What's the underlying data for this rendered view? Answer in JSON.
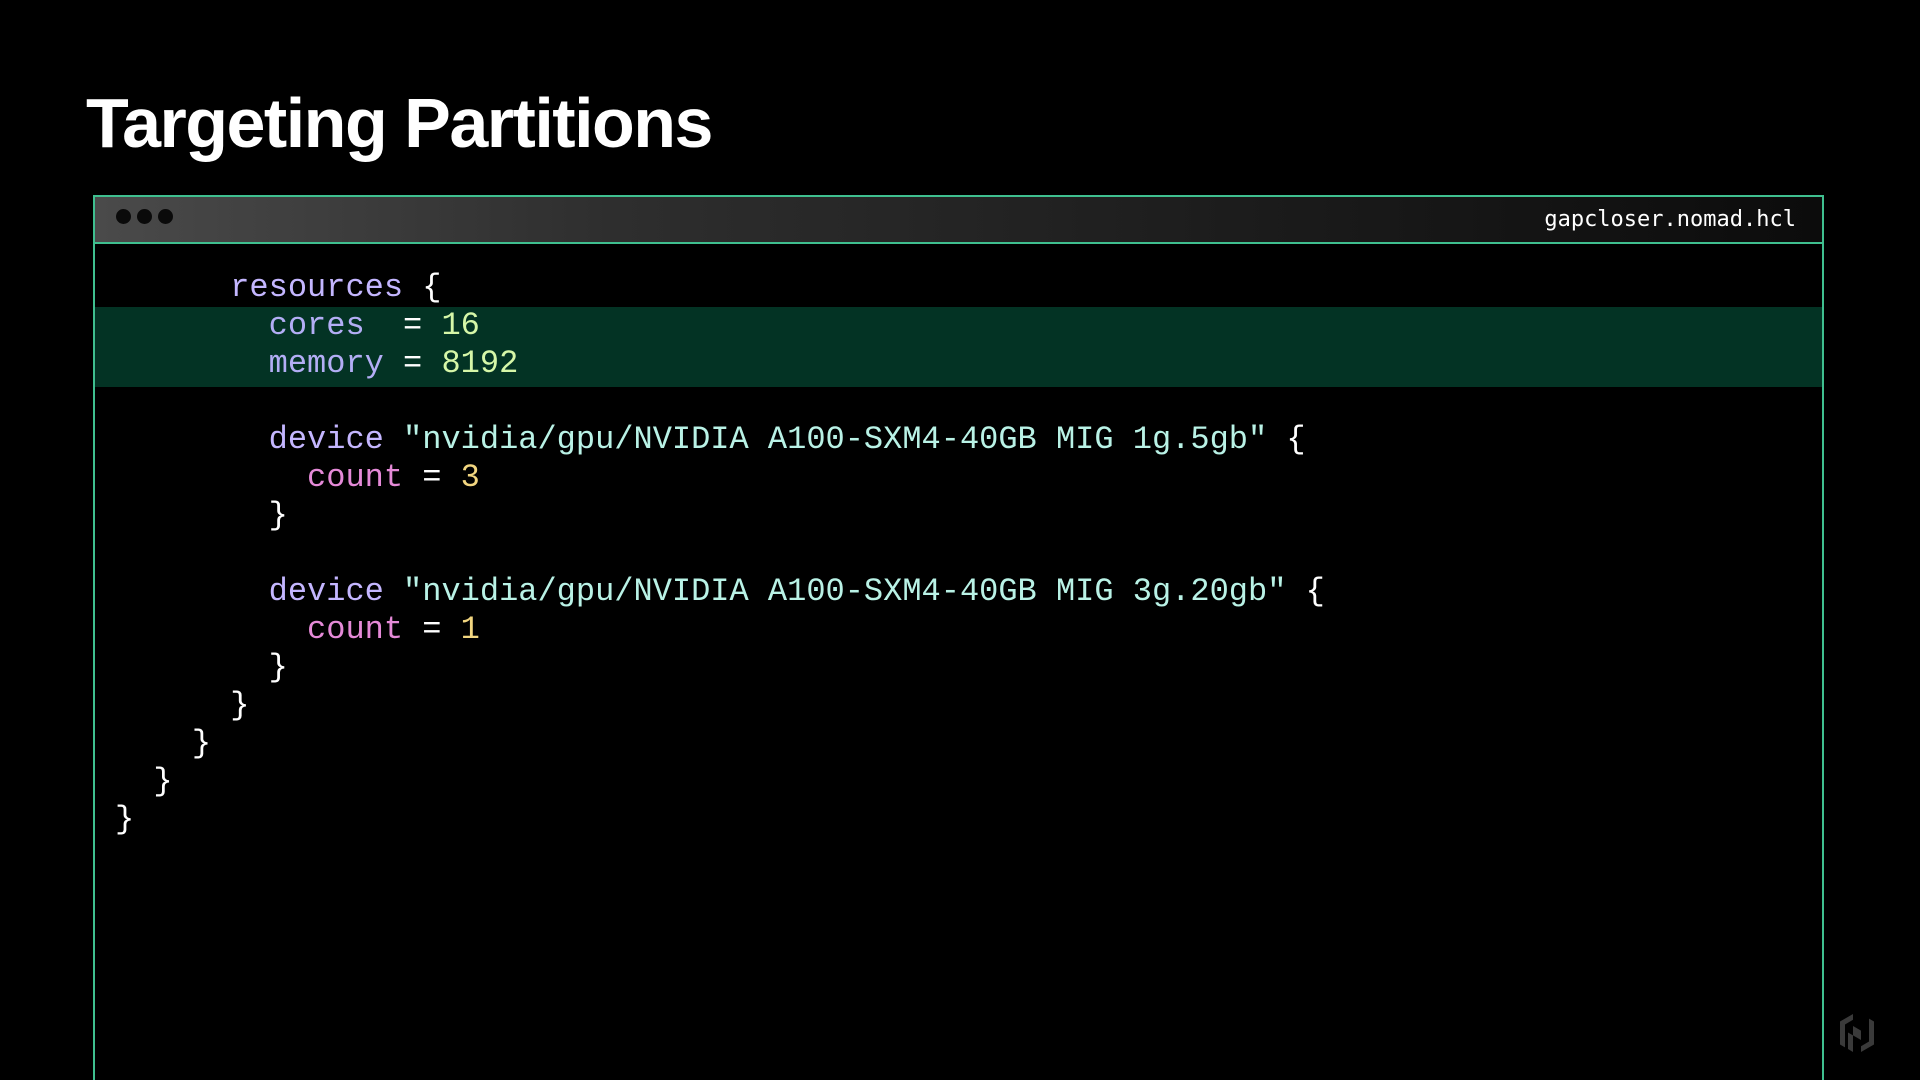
{
  "slide": {
    "title": "Targeting Partitions"
  },
  "window": {
    "filename": "gapcloser.nomad.hcl"
  },
  "code": {
    "line1_keyword": "resources",
    "line1_brace": " {",
    "line2_prop": "cores",
    "line2_eq": "  = ",
    "line2_value": "16",
    "line3_prop": "memory",
    "line3_eq": " = ",
    "line3_value": "8192",
    "line5_keyword": "device",
    "line5_string": " \"nvidia/gpu/NVIDIA A100-SXM4-40GB MIG 1g.5gb\"",
    "line5_brace": " {",
    "line6_attr": "count",
    "line6_eq": " = ",
    "line6_value": "3",
    "line7_brace": "}",
    "line9_keyword": "device",
    "line9_string": " \"nvidia/gpu/NVIDIA A100-SXM4-40GB MIG 3g.20gb\"",
    "line9_brace": " {",
    "line10_attr": "count",
    "line10_eq": " = ",
    "line10_value": "1",
    "line11_brace": "}",
    "line12_brace": "}",
    "line13_brace": "}",
    "line14_brace": "}",
    "line15_brace": "}"
  },
  "colors": {
    "border_accent": "#3fbf8f",
    "highlight_band": "#033324",
    "keyword": "#c4b6ff",
    "attribute": "#e58ad8",
    "number": "#d6f7a8",
    "string": "#b9f2e6"
  },
  "icons": {
    "window_controls": "three-dots-icon",
    "brand_logo": "hashicorp-logo-icon"
  }
}
